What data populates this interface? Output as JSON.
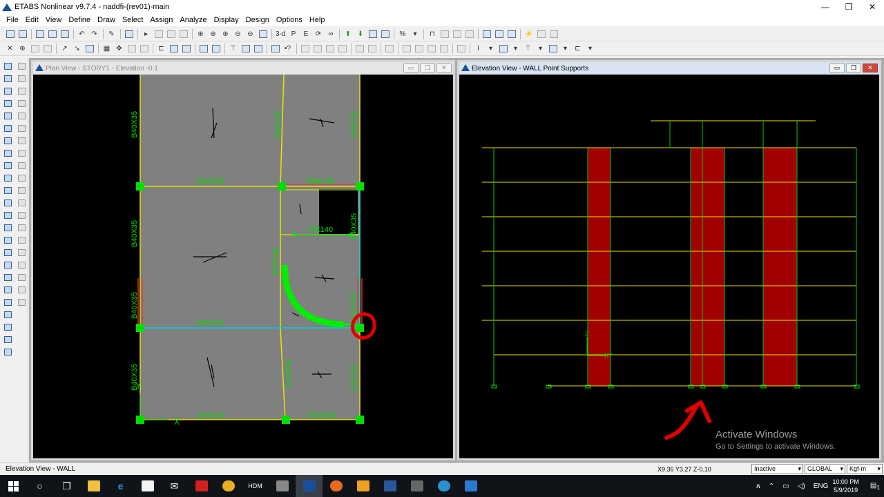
{
  "app": {
    "title": "ETABS Nonlinear v9.7.4 - naddfi-(rev01)-main",
    "minimize": "—",
    "maximize": "❐",
    "close": "✕"
  },
  "menu": [
    "File",
    "Edit",
    "View",
    "Define",
    "Draw",
    "Select",
    "Assign",
    "Analyze",
    "Display",
    "Design",
    "Options",
    "Help"
  ],
  "toolbar": {
    "view3d_label": "3-d"
  },
  "plan_window": {
    "title": "Plan View - STORY1 - Elevation -0.1",
    "beam_labels": [
      "B40X35",
      "B40X35",
      "B40X35",
      "B40X35",
      "B40X35",
      "B40X35",
      "B40X35",
      "B40X35",
      "B40X35",
      "B40X35",
      "B40X35",
      "B40X35",
      "B40X35",
      "B40X35",
      "B40X35",
      "B40X35",
      "B40X35"
    ],
    "ipe_label": "IPE140",
    "axis_x": "X",
    "axis_y": "Y"
  },
  "elevation_window": {
    "title": "Elevation View - WALL  Point Supports",
    "axis_z": "Z",
    "axis_xy": "XY"
  },
  "watermark": {
    "line1": "Activate Windows",
    "line2": "Go to Settings to activate Windows."
  },
  "status": {
    "left": "Elevation View - WALL",
    "coords": "X9.36  Y3.27  Z-0.10",
    "mode": "Inactive",
    "coord_sys": "GLOBAL",
    "units": "Kgf-m"
  },
  "taskbar": {
    "lang": "ENG",
    "time": "10:00 PM",
    "date": "5/9/2019",
    "notif_count": "1"
  },
  "colors": {
    "slab": "#808080",
    "beam": "#e6e600",
    "support": "#00e000",
    "wall": "#a00000",
    "annotation": "#e00000"
  }
}
